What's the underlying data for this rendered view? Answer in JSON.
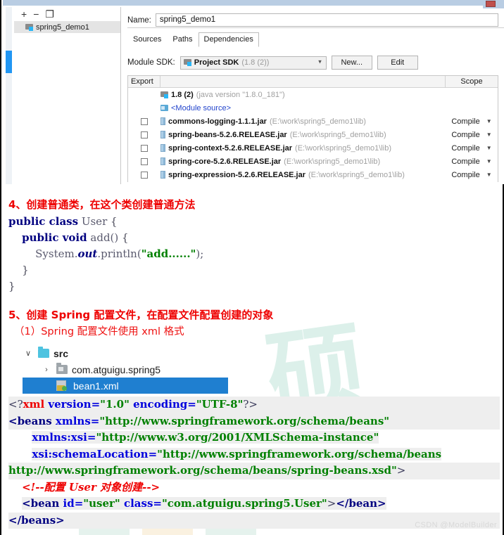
{
  "ide": {
    "modules_toolbar": {
      "add": "+",
      "remove": "−",
      "copy": "❐"
    },
    "module_item": "spring5_demo1",
    "name_label": "Name:",
    "name_value": "spring5_demo1",
    "tabs": [
      {
        "label": "Sources",
        "active": false
      },
      {
        "label": "Paths",
        "active": false
      },
      {
        "label": "Dependencies",
        "active": true
      }
    ],
    "sdk_label": "Module SDK:",
    "sdk_value": "Project SDK",
    "sdk_version": "(1.8 (2))",
    "new_button": "New...",
    "edit_button": "Edit",
    "table": {
      "col_export": "Export",
      "col_scope": "Scope",
      "rows": [
        {
          "type": "sdk",
          "checkbox": false,
          "name": "1.8 (2)",
          "path": "(java version \"1.8.0_181\")",
          "scope": ""
        },
        {
          "type": "source",
          "checkbox": false,
          "name": "<Module source>",
          "path": "",
          "scope": ""
        },
        {
          "type": "jar",
          "checkbox": true,
          "name": "commons-logging-1.1.1.jar",
          "path": "(E:\\work\\spring5_demo1\\lib)",
          "scope": "Compile"
        },
        {
          "type": "jar",
          "checkbox": true,
          "name": "spring-beans-5.2.6.RELEASE.jar",
          "path": "(E:\\work\\spring5_demo1\\lib)",
          "scope": "Compile"
        },
        {
          "type": "jar",
          "checkbox": true,
          "name": "spring-context-5.2.6.RELEASE.jar",
          "path": "(E:\\work\\spring5_demo1\\lib)",
          "scope": "Compile"
        },
        {
          "type": "jar",
          "checkbox": true,
          "name": "spring-core-5.2.6.RELEASE.jar",
          "path": "(E:\\work\\spring5_demo1\\lib)",
          "scope": "Compile"
        },
        {
          "type": "jar",
          "checkbox": true,
          "name": "spring-expression-5.2.6.RELEASE.jar",
          "path": "(E:\\work\\spring5_demo1\\lib)",
          "scope": "Compile"
        }
      ]
    }
  },
  "article": {
    "section4_heading": "4、创建普通类，在这个类创建普通方法",
    "java_code": {
      "l1_kw": "public class",
      "l1_type": " User ",
      "l1_brace": "{",
      "l2_kw": "public void",
      "l2_rest": " add() ",
      "l2_brace": "{",
      "l3_sys": "System.",
      "l3_out": "out",
      "l3_println": ".println(",
      "l3_str": "\"add......\"",
      "l3_end": ");",
      "l4": "}",
      "l5": "}"
    },
    "section5_heading": "5、创建 Spring 配置文件，在配置文件配置创建的对象",
    "section5_sub": "（1）Spring 配置文件使用 xml 格式",
    "file_tree": [
      {
        "arrow": "∨",
        "icon": "folder-open-icon",
        "label": "src",
        "selected": false,
        "indent": 0
      },
      {
        "arrow": "›",
        "icon": "package-folder-icon",
        "label": "com.atguigu.spring5",
        "selected": false,
        "indent": 1
      },
      {
        "arrow": "",
        "icon": "xml-file-icon",
        "label": "bean1.xml",
        "selected": true,
        "indent": 2
      }
    ],
    "xml_code": {
      "decl_open": "<?",
      "decl_name": "xml",
      "decl_attr1": " version=",
      "decl_val1": "\"1.0\"",
      "decl_attr2": " encoding=",
      "decl_val2": "\"UTF-8\"",
      "decl_close": "?>",
      "beans_open": "<beans",
      "a1_name": " xmlns=",
      "a1_val": "\"http://www.springframework.org/schema/beans\"",
      "a2_name": "xmlns:xsi=",
      "a2_val": "\"http://www.w3.org/2001/XMLSchema-instance\"",
      "a3_name": "xsi:schemaLocation=",
      "a3_val": "\"http://www.springframework.org/schema/beans",
      "a3_val_cont": "http://www.springframework.org/schema/beans/spring-beans.xsd\"",
      "a3_gt": ">",
      "comment": "<!--配置 User 对象创建-->",
      "bean_open": "<bean",
      "bean_id_name": " id=",
      "bean_id_val": "\"user\"",
      "bean_class_name": " class=",
      "bean_class_val": "\"com.atguigu.spring5.User\"",
      "bean_gt": ">",
      "bean_close": "</bean>",
      "beans_close": "</beans>"
    }
  },
  "watermark": {
    "csdn": "CSDN @ModelBuilder"
  }
}
